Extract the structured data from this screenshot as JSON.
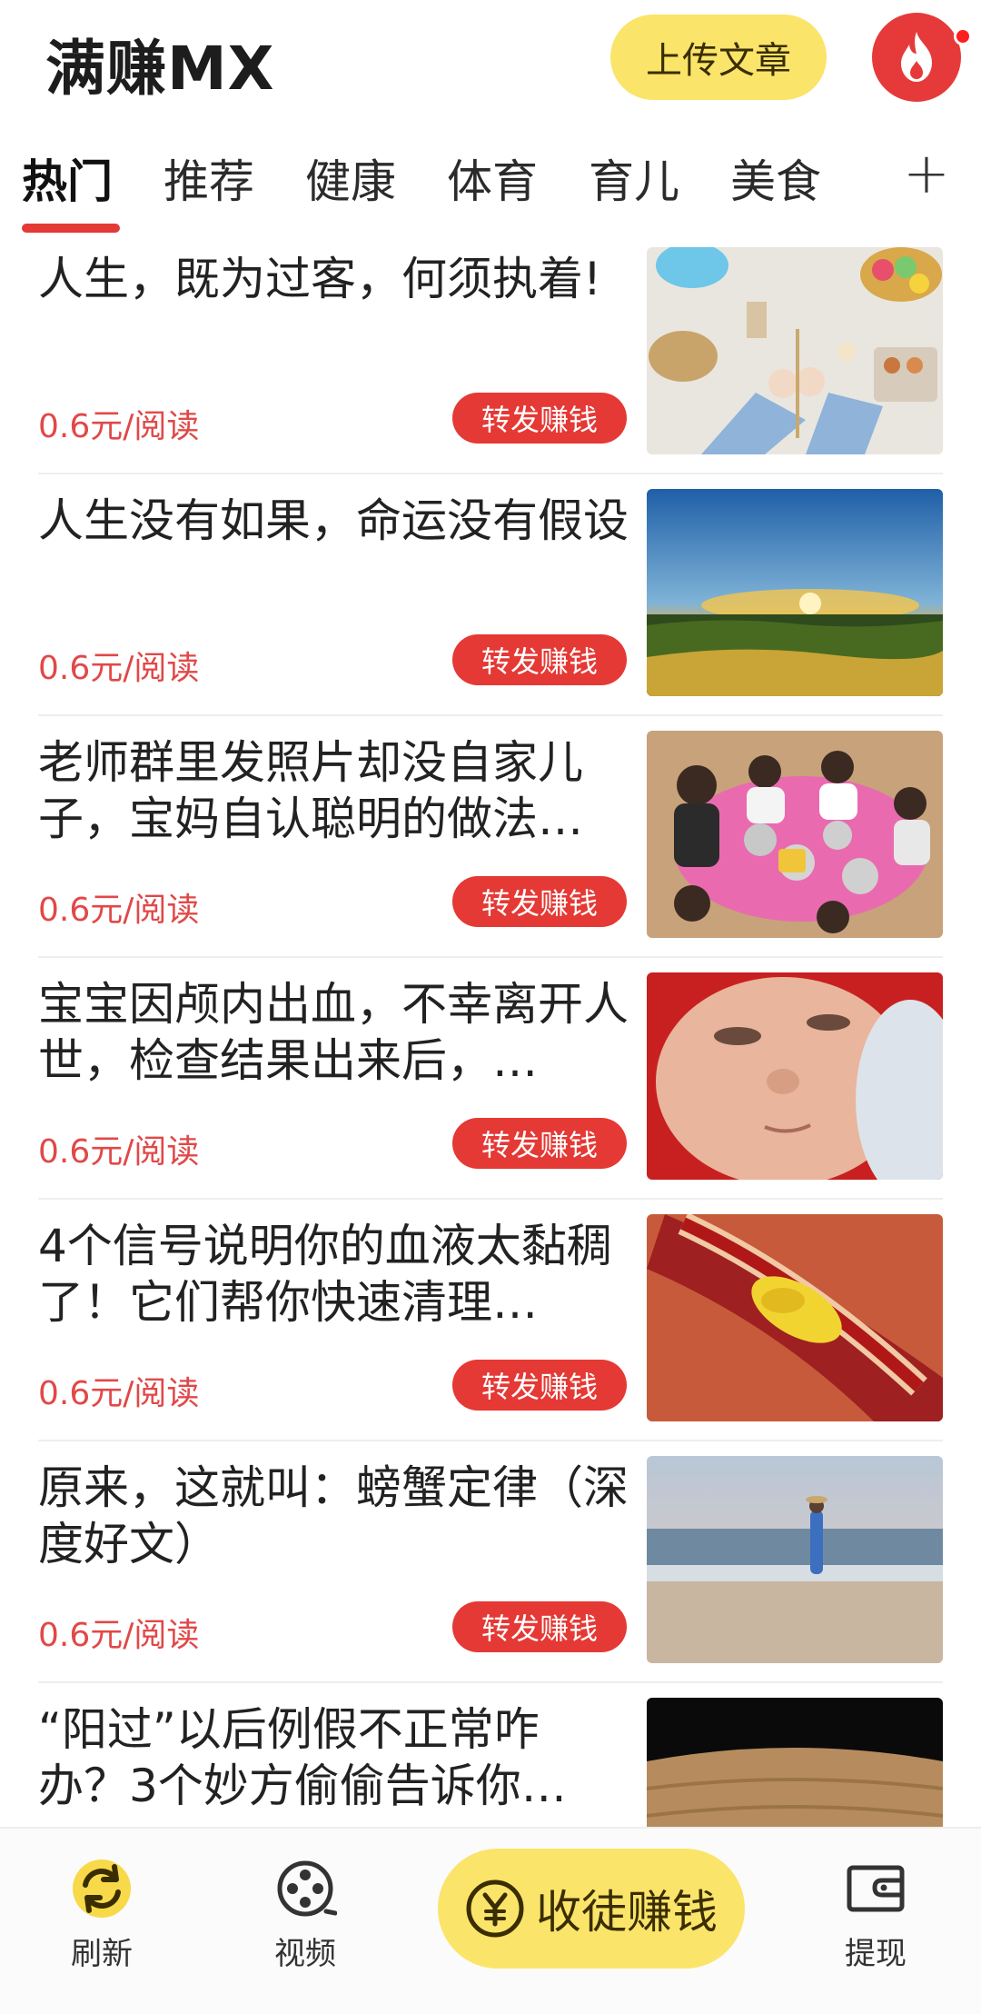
{
  "header": {
    "title": "满赚MX",
    "upload_label": "上传文章",
    "fire_icon": "flame-icon"
  },
  "tabs": [
    {
      "label": "热门",
      "active": true
    },
    {
      "label": "推荐"
    },
    {
      "label": "健康"
    },
    {
      "label": "体育"
    },
    {
      "label": "育儿"
    },
    {
      "label": "美食"
    }
  ],
  "tabs_add": "+",
  "feed": [
    {
      "title": "人生，既为过客，何须执着!",
      "price": "0.6元/阅读",
      "share": "转发赚钱",
      "thumb": "easter-eggs-craft"
    },
    {
      "title": "人生没有如果，命运没有假设",
      "price": "0.6元/阅读",
      "share": "转发赚钱",
      "thumb": "sunset-sunflower-field"
    },
    {
      "title": "老师群里发照片却没自家儿子，宝妈自认聪明的做法…",
      "price": "0.6元/阅读",
      "share": "转发赚钱",
      "thumb": "kids-eating-at-table"
    },
    {
      "title": "宝宝因颅内出血，不幸离开人世，检查结果出来后，…",
      "price": "0.6元/阅读",
      "share": "转发赚钱",
      "thumb": "sleeping-baby"
    },
    {
      "title": "4个信号说明你的血液太黏稠了！它们帮你快速清理…",
      "price": "0.6元/阅读",
      "share": "转发赚钱",
      "thumb": "blood-vessel-plaque"
    },
    {
      "title": "原来，这就叫：螃蟹定律（深度好文）",
      "price": "0.6元/阅读",
      "share": "转发赚钱",
      "thumb": "woman-on-beach"
    },
    {
      "title": "“阳过”以后例假不正常咋办？3个妙方偷偷告诉你…",
      "price": "",
      "share": "",
      "thumb": "dark-sand-dunes"
    }
  ],
  "bottom_nav": {
    "refresh_label": "刷新",
    "video_label": "视频",
    "invite_label": "收徒赚钱",
    "withdraw_label": "提现"
  },
  "colors": {
    "accent_red": "#e53935",
    "accent_yellow": "#fbe46a",
    "price_red": "#e14848"
  }
}
